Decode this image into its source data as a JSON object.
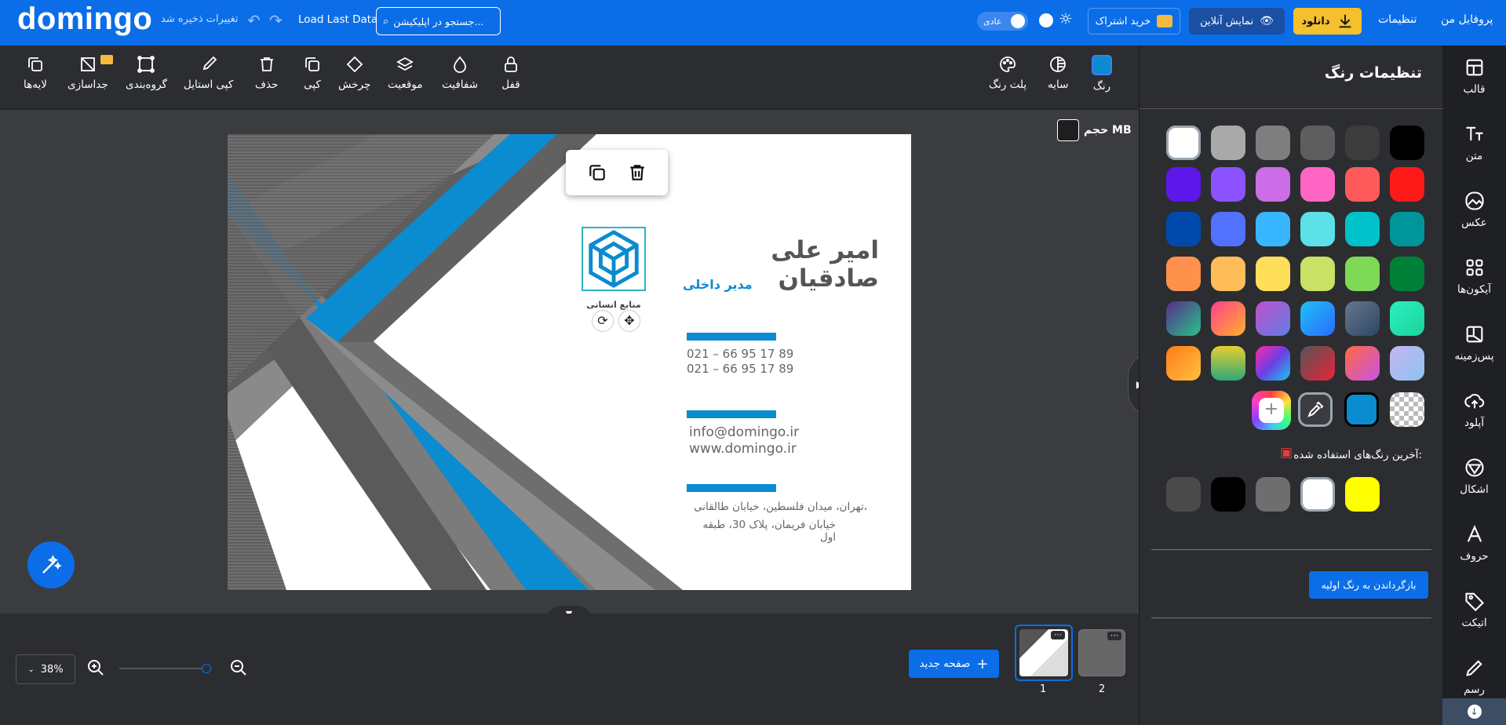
{
  "topbar": {
    "logo": "domingo",
    "profile": "پروفایل من",
    "settings": "تنظیمات",
    "download": "دانلود",
    "preview": "نمایش آنلاین",
    "subscribe": "خرید اشتراک",
    "mode": "عادی",
    "load_last": "Load Last Data",
    "search_placeholder": "جستجو در اپلیکیشن...",
    "saved": "تغییرات ذخیره شد"
  },
  "toolbar": {
    "color": "رنگ",
    "shadow": "سایه",
    "palette": "پلت رنگ",
    "lock": "قفل",
    "opacity": "شفافیت",
    "position": "موقعیت",
    "rotate": "چرخش",
    "copy": "کپی",
    "delete": "حذف",
    "copy_style": "کپی استایل",
    "group": "گروه‌بندی",
    "ungroup": "جداسازی",
    "layers": "لایه‌ها",
    "size_label": "حجم MB"
  },
  "card": {
    "name": "امیر علی صادقیان",
    "title": "مدیر داخلی",
    "phone1": "021 – 66 95 17 89",
    "phone2": "021 – 66 95 17 89",
    "email": "info@domingo.ir",
    "web": "www.domingo.ir",
    "address1": "تهران، میدان فلسطین، خیابان طالقانی،",
    "address2": "خیابان فریمان، پلاک 30، طبقه اول",
    "logo_text": "منابع انسانی"
  },
  "panel": {
    "title": "تنظیمات رنگ",
    "recent_label": "آخرین رنگ‌های استفاده شده:",
    "reset": "بازگرداندن به رنگ اولیه",
    "swatches": [
      [
        "#000000",
        "#3c3c3c",
        "#5e5e5e",
        "#7e7e7e",
        "#a9a9a9",
        "#d9d9d9",
        "#ffffff"
      ],
      [
        "#ff1a1a",
        "#ff5a5a",
        "#ff66c4",
        "#cc6ce7",
        "#8c52ff",
        "#5e17eb"
      ],
      [
        "#00959a",
        "#00c2cb",
        "#5ce1e6",
        "#38b6ff",
        "#5271ff",
        "#004aad"
      ],
      [
        "#008037",
        "#7ed957",
        "#c9e265",
        "#ffde59",
        "#ffbd59",
        "#ff914d"
      ]
    ],
    "recent": [
      "#ffff00",
      "#ffffff",
      "#6e6e6e",
      "#000000",
      "#4a4a4a"
    ],
    "selected_color": "#0b8bd0"
  },
  "sidebar": {
    "template": "قالب",
    "text": "متن",
    "photo": "عکس",
    "icons": "آیکون‌ها",
    "background": "پس‌زمینه",
    "upload": "آپلود",
    "shapes": "اشکال",
    "letters": "حروف",
    "tag": "اتیکت",
    "draw": "رسم"
  },
  "bottom": {
    "zoom": "38%",
    "new_page": "صفحه جدید",
    "page1": "1",
    "page2": "2"
  }
}
